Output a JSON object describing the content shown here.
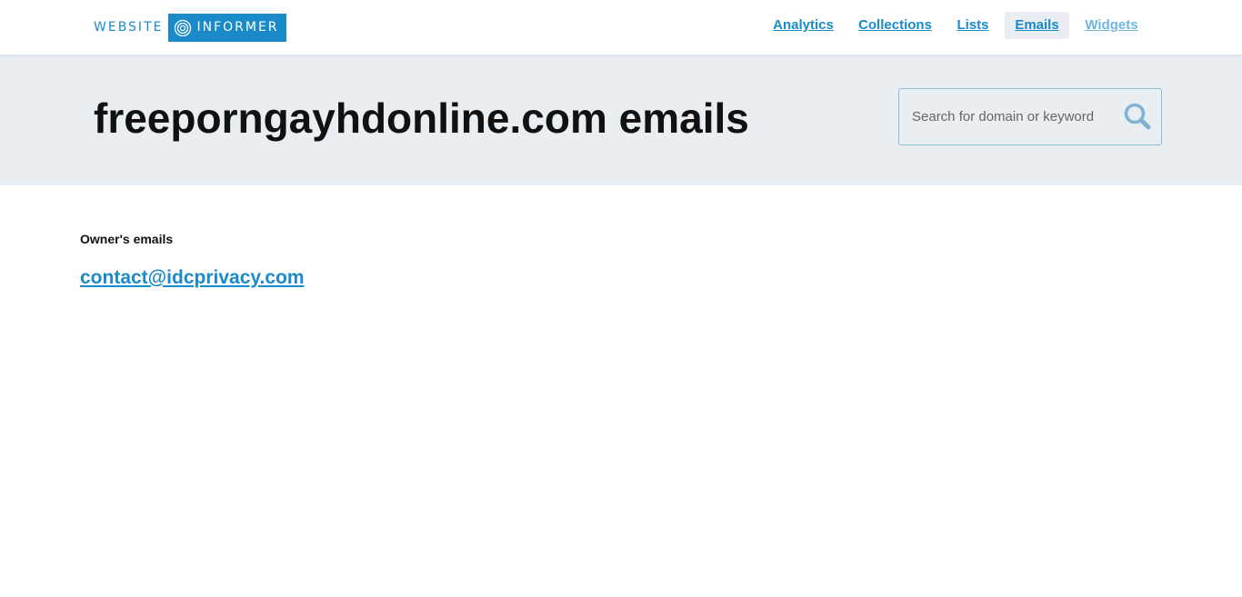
{
  "logo": {
    "left_text": "WEBSITE",
    "right_text": "INFORMER"
  },
  "nav": {
    "items": [
      {
        "label": "Analytics"
      },
      {
        "label": "Collections"
      },
      {
        "label": "Lists"
      },
      {
        "label": "Emails"
      },
      {
        "label": "Widgets"
      }
    ]
  },
  "hero": {
    "title": "freeporngayhdonline.com emails",
    "search": {
      "placeholder": "Search for domain or keyword",
      "value": ""
    }
  },
  "content": {
    "section_label": "Owner's emails",
    "emails": [
      "contact@idcprivacy.com"
    ]
  },
  "colors": {
    "brand": "#1a8ac9",
    "hero_bg": "#e9eef2",
    "nav_active_bg": "#eaeef2",
    "text": "#111111"
  },
  "icons": {
    "logo": "radar-target-icon",
    "search": "search-icon"
  }
}
